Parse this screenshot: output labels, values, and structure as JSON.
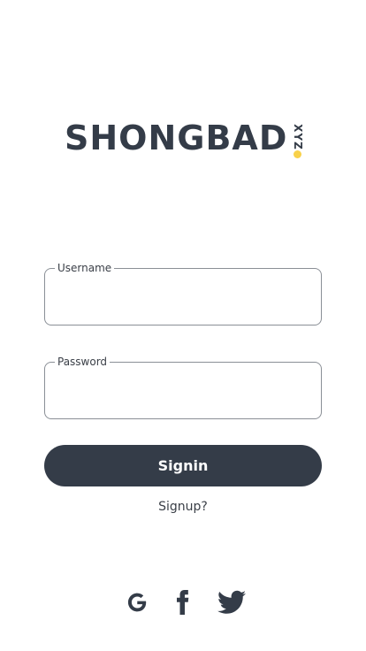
{
  "logo": {
    "wordmark": "SHONGBAD",
    "tld": "XYZ",
    "brand_color": "#343c48",
    "dot_color": "#f8d14a"
  },
  "form": {
    "username_label": "Username",
    "username_value": "",
    "password_label": "Password",
    "password_value": ""
  },
  "actions": {
    "signin_label": "Signin",
    "signup_label": "Signup?"
  },
  "social": {
    "icons": [
      "google-icon",
      "facebook-icon",
      "twitter-icon"
    ]
  }
}
